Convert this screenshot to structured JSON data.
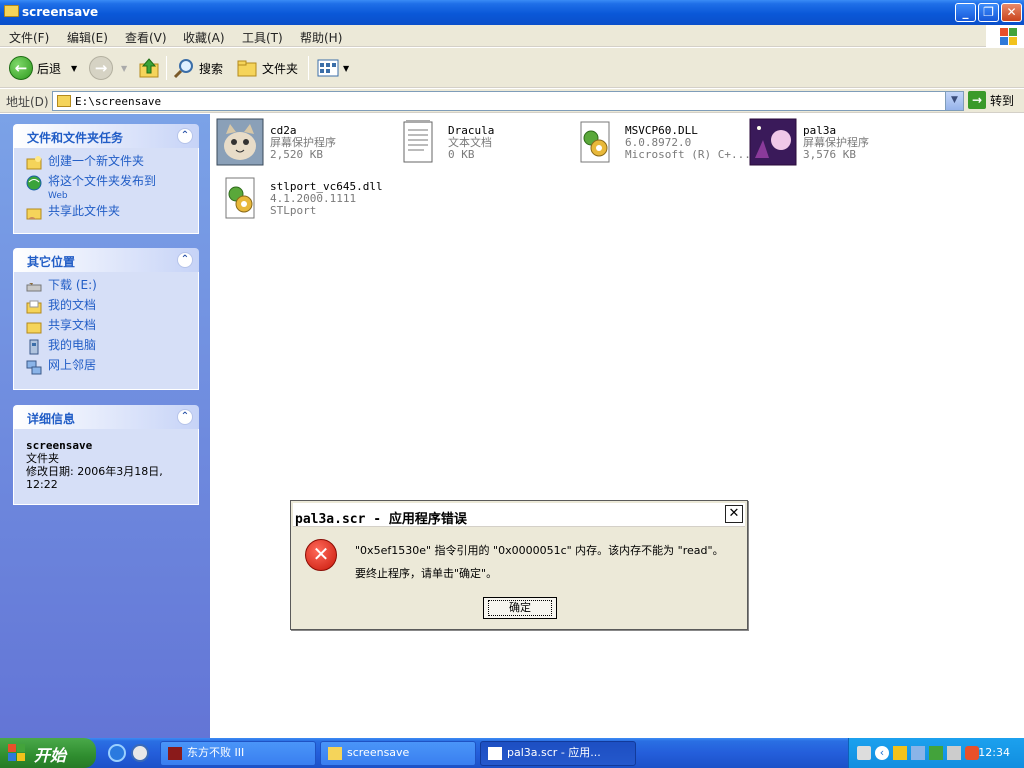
{
  "window": {
    "title": "screensave"
  },
  "menu": [
    "文件(F)",
    "编辑(E)",
    "查看(V)",
    "收藏(A)",
    "工具(T)",
    "帮助(H)"
  ],
  "toolbar": {
    "back_label": "后退",
    "search_label": "搜索",
    "folders_label": "文件夹"
  },
  "address": {
    "label": "地址(D)",
    "value": "E:\\screensave",
    "go_label": "转到"
  },
  "panels": {
    "tasks": {
      "title": "文件和文件夹任务",
      "items": [
        {
          "label": "创建一个新文件夹",
          "icon": "new-folder-icon"
        },
        {
          "label": "将这个文件夹发布到",
          "sub": "Web",
          "icon": "globe-icon"
        },
        {
          "label": "共享此文件夹",
          "icon": "share-folder-icon"
        }
      ]
    },
    "places": {
      "title": "其它位置",
      "items": [
        {
          "label": "下载 (E:)",
          "icon": "drive-icon"
        },
        {
          "label": "我的文档",
          "icon": "documents-folder-icon"
        },
        {
          "label": "共享文档",
          "icon": "shared-folder-icon"
        },
        {
          "label": "我的电脑",
          "icon": "computer-icon"
        },
        {
          "label": "网上邻居",
          "icon": "network-icon"
        }
      ]
    },
    "details": {
      "title": "详细信息",
      "name": "screensave",
      "type": "文件夹",
      "modified": "修改日期: 2006年3月18日, 12:22"
    }
  },
  "files": [
    {
      "name": "cd2a",
      "type": "屏幕保护程序",
      "size": "2,520 KB",
      "icon": "cat-screensaver-icon"
    },
    {
      "name": "Dracula",
      "type": "文本文档",
      "size": "0 KB",
      "icon": "text-document-icon"
    },
    {
      "name": "MSVCP60.DLL",
      "type": "6.0.8972.0",
      "size": "Microsoft (R) C+...",
      "icon": "dll-gear-icon"
    },
    {
      "name": "pal3a",
      "type": "屏幕保护程序",
      "size": "3,576 KB",
      "icon": "pal3a-screensaver-icon"
    },
    {
      "name": "stlport_vc645.dll",
      "type": "4.1.2000.1111",
      "size": "STLport",
      "icon": "dll-gear-icon"
    }
  ],
  "dialog": {
    "title": "pal3a.scr - 应用程序错误",
    "line1": "\"0x5ef1530e\" 指令引用的 \"0x0000051c\" 内存。该内存不能为 \"read\"。",
    "line2": "要终止程序，请单击\"确定\"。",
    "ok": "确定"
  },
  "taskbar": {
    "start": "开始",
    "tasks": [
      "东方不败 III",
      "screensave",
      "pal3a.scr - 应用..."
    ],
    "clock": "12:34"
  },
  "colors": {
    "title_blue": "#0a58d8",
    "link_blue": "#215dc6",
    "pane_blue": "#7ba2e7"
  }
}
